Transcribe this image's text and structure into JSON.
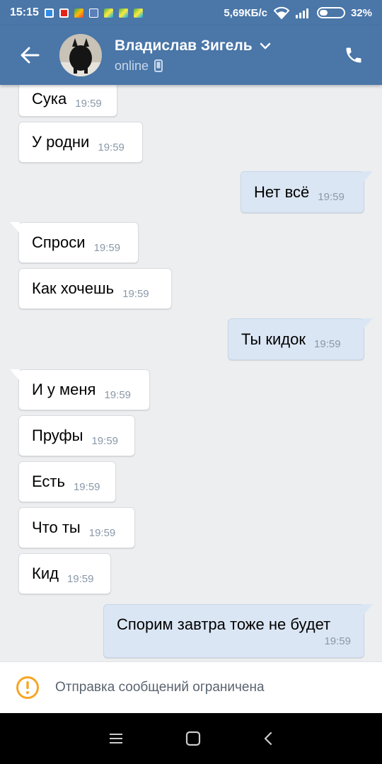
{
  "status_bar": {
    "time": "15:15",
    "network_speed": "5,69КБ/с",
    "battery_percent": "32%",
    "battery_level": 0.32,
    "notification_icons": [
      "app-blue-icon",
      "youtube-icon",
      "maps-icon",
      "vk-icon",
      "shuttle-icon",
      "shuttle-icon",
      "shuttle-icon"
    ],
    "icons": [
      "wifi-icon",
      "signal-icon",
      "battery-icon"
    ]
  },
  "header": {
    "contact_name": "Владислав Зигель",
    "status": "online",
    "back_icon": "arrow-left-icon",
    "call_icon": "phone-icon",
    "dropdown_icon": "chevron-down-icon",
    "device_icon": "mobile-icon",
    "color": "#4a76a8"
  },
  "messages": [
    {
      "direction": "in",
      "text": "Сука",
      "time": "19:59"
    },
    {
      "direction": "in",
      "text": "У родни",
      "time": "19:59"
    },
    {
      "direction": "out",
      "text": "Нет всё",
      "time": "19:59"
    },
    {
      "direction": "in",
      "text": "Спроси",
      "time": "19:59"
    },
    {
      "direction": "in",
      "text": "Как хочешь",
      "time": "19:59"
    },
    {
      "direction": "out",
      "text": "Ты кидок",
      "time": "19:59"
    },
    {
      "direction": "in",
      "text": "И у меня",
      "time": "19:59"
    },
    {
      "direction": "in",
      "text": "Пруфы",
      "time": "19:59"
    },
    {
      "direction": "in",
      "text": "Есть",
      "time": "19:59"
    },
    {
      "direction": "in",
      "text": "Что ты",
      "time": "19:59"
    },
    {
      "direction": "in",
      "text": "Кид",
      "time": "19:59"
    },
    {
      "direction": "out",
      "text": "Спорим завтра тоже не будет",
      "time": "19:59"
    }
  ],
  "restriction": {
    "icon": "warning-icon",
    "text": "Отправка сообщений ограничена",
    "color": "#f5a623"
  },
  "navbar": {
    "icons": [
      "menu-icon",
      "home-square-icon",
      "back-triangle-icon"
    ]
  }
}
